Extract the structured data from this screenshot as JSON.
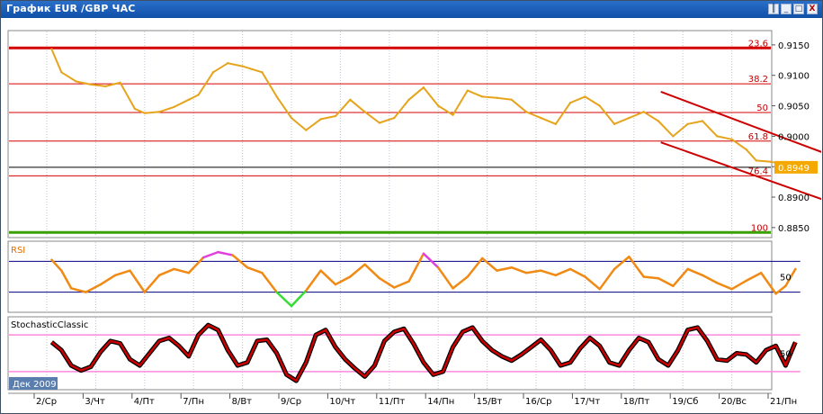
{
  "window": {
    "title": "График EUR /GBP  ЧАС",
    "buttons": [
      "║",
      "_",
      "□",
      "X"
    ]
  },
  "chart_data": [
    {
      "type": "line",
      "name": "price",
      "y_ticks": [
        "0.9150",
        "0.9100",
        "0.9050",
        "0.9000",
        "0.8950",
        "0.8900",
        "0.8850"
      ],
      "y_tick_values": [
        0.915,
        0.91,
        0.905,
        0.9,
        0.895,
        0.89,
        0.885
      ],
      "ylim": [
        0.8835,
        0.9172
      ],
      "current_price": "0.8949",
      "current_value": 0.8949,
      "fib_levels": [
        {
          "label": "23.6",
          "value": 0.9145
        },
        {
          "label": "38.2",
          "value": 0.9086
        },
        {
          "label": "50",
          "value": 0.9039
        },
        {
          "label": "61.8",
          "value": 0.8992
        },
        {
          "label": "76.4",
          "value": 0.8935
        },
        {
          "label": "100",
          "value": 0.8842
        }
      ],
      "channel": [
        {
          "from": [
            13.55,
            0.9073
          ],
          "to": [
            17.9,
            0.8942
          ]
        },
        {
          "from": [
            13.55,
            0.899
          ],
          "to": [
            17.0,
            0.8892
          ]
        }
      ],
      "series": [
        {
          "x": [
            1.1,
            1.3,
            1.6,
            1.9,
            2.2,
            2.5,
            2.8,
            3.0,
            3.3,
            3.6,
            3.9,
            4.1,
            4.4,
            4.7,
            5.0,
            5.2,
            5.4,
            5.7,
            6.0,
            6.3,
            6.6,
            6.9,
            7.2,
            7.5,
            7.8,
            8.1,
            8.4,
            8.7,
            9.0,
            9.3,
            9.6,
            9.9,
            10.2,
            10.5,
            10.8,
            11.1,
            11.4,
            11.7,
            12.0,
            12.3,
            12.6,
            12.9,
            13.2,
            13.5,
            13.8,
            14.1,
            14.4,
            14.7,
            15.0,
            15.3,
            15.5,
            15.8,
            16.0,
            16.2
          ],
          "y": [
            0.9143,
            0.9105,
            0.909,
            0.9085,
            0.9082,
            0.9088,
            0.9045,
            0.9038,
            0.904,
            0.9048,
            0.906,
            0.9068,
            0.9105,
            0.912,
            0.9115,
            0.911,
            0.9105,
            0.9065,
            0.903,
            0.901,
            0.9028,
            0.9033,
            0.906,
            0.904,
            0.9022,
            0.903,
            0.906,
            0.908,
            0.905,
            0.9035,
            0.9075,
            0.9065,
            0.9063,
            0.906,
            0.904,
            0.903,
            0.902,
            0.9055,
            0.9065,
            0.905,
            0.902,
            0.903,
            0.904,
            0.9025,
            0.9,
            0.902,
            0.9025,
            0.9,
            0.8995,
            0.8978,
            0.896,
            0.8958,
            0.8955,
            0.8948
          ]
        }
      ]
    },
    {
      "type": "line",
      "name": "oscillator-1",
      "title": "RSI",
      "y_ticks": [
        "50"
      ],
      "levels": [
        70,
        30
      ],
      "ylim": [
        5,
        95
      ],
      "series": [
        {
          "x": [
            1.1,
            1.3,
            1.5,
            1.8,
            2.1,
            2.4,
            2.7,
            3.0,
            3.3,
            3.6,
            3.9,
            4.2,
            4.5,
            4.8,
            5.1,
            5.4,
            5.7,
            6.0,
            6.3,
            6.6,
            6.9,
            7.2,
            7.5,
            7.8,
            8.1,
            8.4,
            8.7,
            9.0,
            9.3,
            9.6,
            9.9,
            10.2,
            10.5,
            10.8,
            11.1,
            11.4,
            11.7,
            12.0,
            12.3,
            12.6,
            12.9,
            13.2,
            13.5,
            13.8,
            14.1,
            14.4,
            14.7,
            15.0,
            15.3,
            15.6,
            15.9,
            16.1,
            16.3
          ],
          "y": [
            72,
            58,
            35,
            30,
            40,
            52,
            58,
            30,
            52,
            60,
            55,
            75,
            82,
            78,
            62,
            55,
            30,
            12,
            32,
            58,
            40,
            50,
            66,
            48,
            36,
            44,
            80,
            62,
            35,
            50,
            74,
            58,
            62,
            55,
            58,
            52,
            60,
            50,
            34,
            60,
            76,
            50,
            48,
            38,
            60,
            52,
            42,
            34,
            45,
            55,
            28,
            38,
            60
          ]
        }
      ]
    },
    {
      "type": "line",
      "name": "oscillator-2",
      "title": "StochasticClassic",
      "y_ticks": [
        "50"
      ],
      "levels": [
        80,
        20
      ],
      "ylim": [
        -8,
        108
      ],
      "series": [
        {
          "x": [
            1.1,
            1.3,
            1.5,
            1.7,
            1.9,
            2.1,
            2.3,
            2.5,
            2.7,
            2.9,
            3.1,
            3.3,
            3.5,
            3.7,
            3.9,
            4.1,
            4.3,
            4.5,
            4.7,
            4.9,
            5.1,
            5.3,
            5.5,
            5.7,
            5.9,
            6.1,
            6.3,
            6.5,
            6.7,
            6.9,
            7.1,
            7.3,
            7.5,
            7.7,
            7.9,
            8.1,
            8.3,
            8.5,
            8.7,
            8.9,
            9.1,
            9.3,
            9.5,
            9.7,
            9.9,
            10.1,
            10.3,
            10.5,
            10.7,
            10.9,
            11.1,
            11.3,
            11.5,
            11.7,
            11.9,
            12.1,
            12.3,
            12.5,
            12.7,
            12.9,
            13.1,
            13.3,
            13.5,
            13.7,
            13.9,
            14.1,
            14.3,
            14.5,
            14.7,
            14.9,
            15.1,
            15.3,
            15.5,
            15.7,
            15.9,
            16.1,
            16.3
          ],
          "y": [
            68,
            55,
            30,
            22,
            28,
            52,
            70,
            66,
            40,
            30,
            50,
            70,
            75,
            62,
            45,
            80,
            96,
            88,
            55,
            30,
            35,
            70,
            72,
            50,
            15,
            5,
            35,
            80,
            88,
            60,
            40,
            25,
            12,
            30,
            70,
            85,
            90,
            65,
            35,
            15,
            20,
            60,
            85,
            92,
            70,
            55,
            45,
            38,
            48,
            60,
            72,
            55,
            30,
            35,
            58,
            75,
            62,
            35,
            30,
            55,
            75,
            68,
            40,
            30,
            55,
            88,
            92,
            70,
            40,
            38,
            50,
            48,
            35,
            55,
            62,
            30,
            68
          ]
        }
      ]
    }
  ],
  "x_axis": {
    "labels": [
      "2/Ср",
      "3/Чт",
      "4/Пт",
      "7/Пн",
      "8/Вт",
      "9/Ср",
      "10/Чт",
      "11/Пт",
      "14/Пн",
      "15/Вт",
      "16/Ср",
      "17/Чт",
      "18/Пт",
      "19/Сб",
      "20/Вс",
      "21/Пн"
    ],
    "positions": [
      1,
      2,
      3,
      4,
      5,
      6,
      7,
      8,
      9,
      10,
      11,
      12,
      13,
      14,
      15,
      16
    ],
    "period_label": "Дек 2009"
  },
  "colors": {
    "price_line": "#e6a41c",
    "fib_line": "#d40000",
    "fib_bold": "#cc0000",
    "green_line": "#3aa000",
    "current_line": "#000000",
    "channel": "#cc0000",
    "rsi_line": "#f08a14",
    "rsi_low": "#33dd33",
    "rsi_high": "#e040e0",
    "stoch_main": "#cc0000",
    "stoch_shadow": "#000000",
    "stoch_levels": "#ff88dd",
    "rsi_levels": "#000080",
    "price_badge": "#f5a800",
    "title_bg": "#1a5bbd",
    "period_badge": "#5a7fae"
  },
  "icons": [
    "restore-icon",
    "minimize-icon",
    "maximize-icon",
    "close-icon"
  ]
}
